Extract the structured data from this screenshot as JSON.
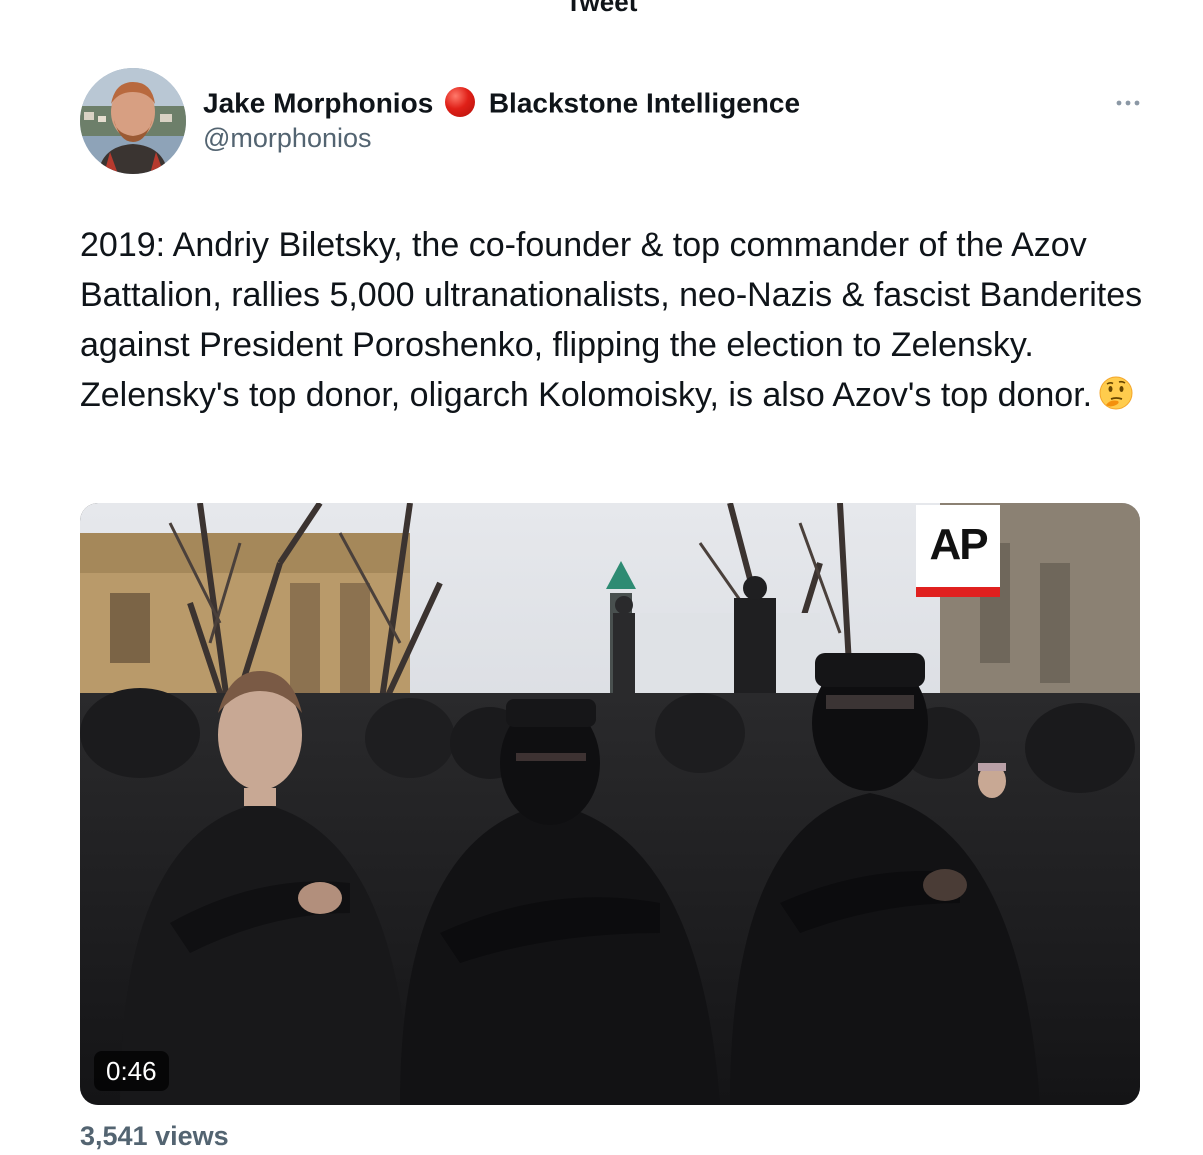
{
  "header": {
    "title": "Tweet"
  },
  "tweet": {
    "author": {
      "name": "Jake Morphonios",
      "org": "Blackstone Intelligence",
      "handle": "@morphonios"
    },
    "text": "2019: Andriy Biletsky, the co-founder & top commander of the Azov Battalion, rallies 5,000 ultranationalists, neo-Nazis & fascist Banderites against President Poroshenko, flipping the election to Zelensky. Zelensky's top donor, oligarch Kolomoisky, is also Azov's top donor.",
    "emoji": "thinking-face",
    "media": {
      "watermark": "AP",
      "duration": "0:46"
    },
    "views": "3,541 views"
  },
  "icons": {
    "more": "more-horizontal-icon",
    "dot": "red-circle-icon"
  },
  "colors": {
    "text": "#0f1419",
    "secondary": "#536471",
    "red_dot": "#e02018",
    "ap_red": "#e0201f"
  }
}
